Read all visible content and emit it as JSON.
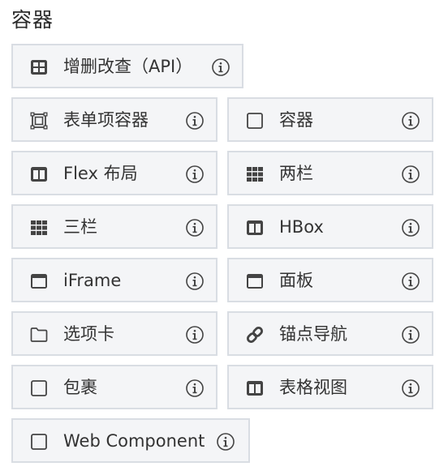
{
  "section": {
    "title": "容器"
  },
  "colors": {
    "tile_bg": "#f4f5f7",
    "tile_border": "#d9dde3",
    "text": "#333333",
    "icon": "#444444"
  },
  "components": [
    {
      "label": "增删改查（API）",
      "icon": "table-icon"
    },
    {
      "label": "表单项容器",
      "icon": "form-item-container-icon"
    },
    {
      "label": "容器",
      "icon": "square-icon"
    },
    {
      "label": "Flex 布局",
      "icon": "columns-icon"
    },
    {
      "label": "两栏",
      "icon": "grid-icon"
    },
    {
      "label": "三栏",
      "icon": "grid-icon"
    },
    {
      "label": "HBox",
      "icon": "columns-icon"
    },
    {
      "label": "iFrame",
      "icon": "window-icon"
    },
    {
      "label": "面板",
      "icon": "window-icon"
    },
    {
      "label": "选项卡",
      "icon": "folder-icon"
    },
    {
      "label": "锚点导航",
      "icon": "link-icon"
    },
    {
      "label": "包裹",
      "icon": "square-icon"
    },
    {
      "label": "表格视图",
      "icon": "columns-icon"
    },
    {
      "label": "Web Component",
      "icon": "square-icon"
    }
  ]
}
